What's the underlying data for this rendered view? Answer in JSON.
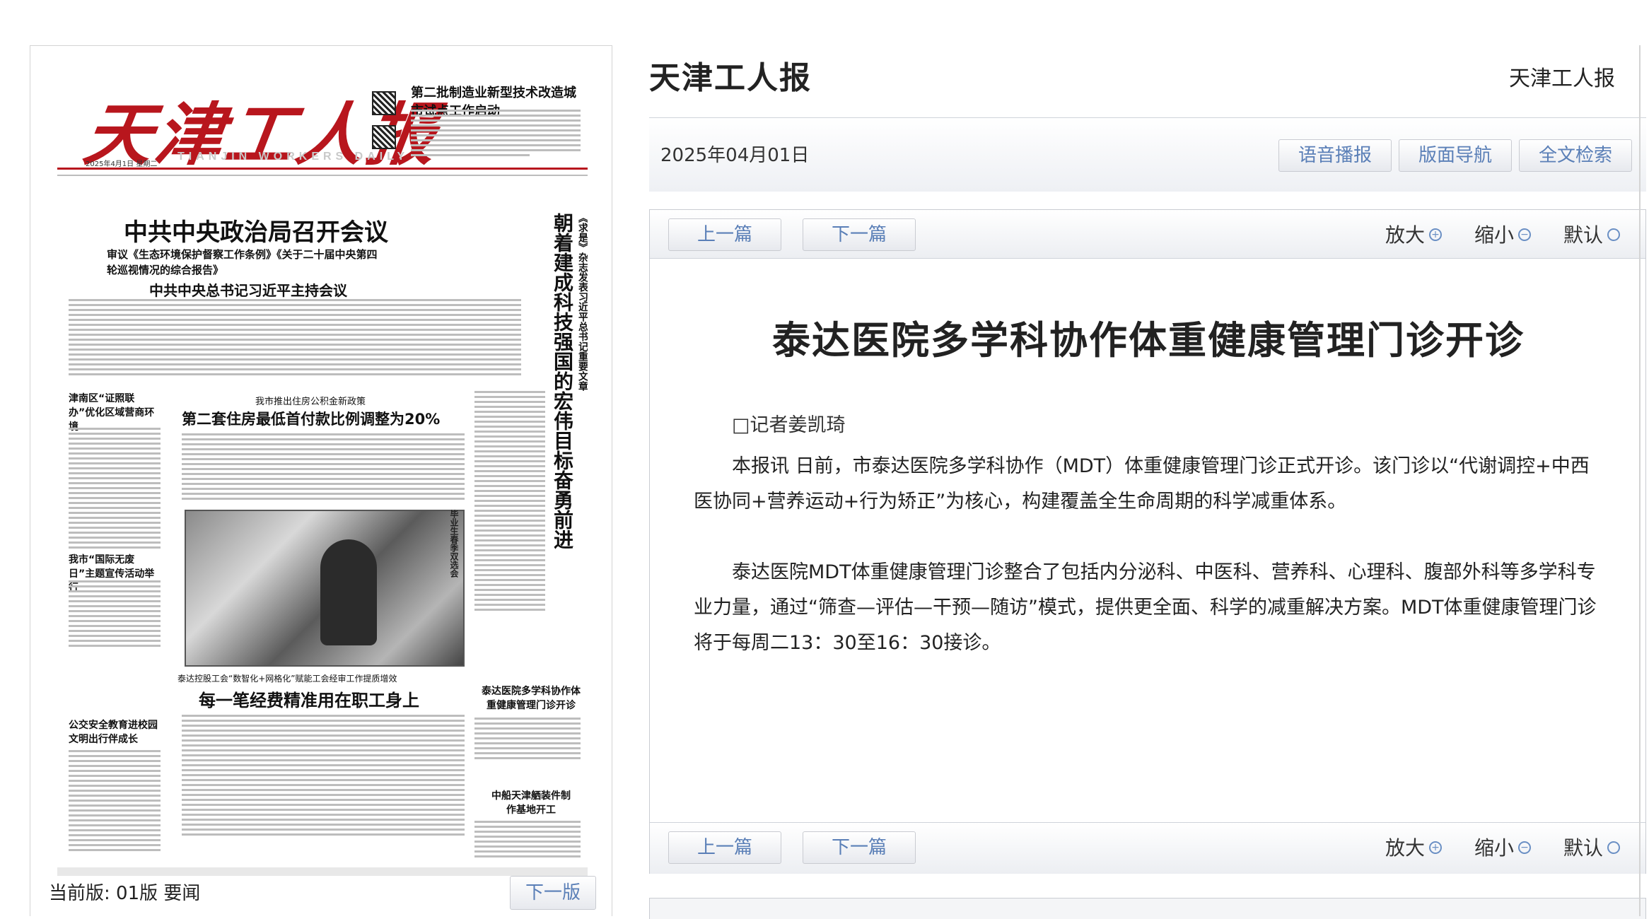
{
  "newspaper": {
    "logo_text": "天津工人报",
    "logo_english": "TIANJIN WORKERS DAILY",
    "top_story_right": "第二批制造业新型技术改造城市试点工作启动",
    "masthead_date": "2025年4月1日 星期二",
    "main_headline": "中共中央政治局召开会议",
    "sub_line_1": "审议《生态环境保护督察工作条例》《关于二十届中央第四",
    "sub_line_2": "轮巡视情况的综合报告》",
    "sub_line_3": "中共中央总书记习近平主持会议",
    "vertical_headline": "朝着建成科技强国的宏伟目标奋勇前进",
    "vertical_small": "《求是》杂志发表习近平总书记重要文章",
    "left_story_1": "津南区“证照联办”优化区域营商环境",
    "kicker_housing": "我市推出住房公积金新政策",
    "housing_headline": "第二套住房最低首付款比例调整为20%",
    "left_story_2": "我市“国际无废日”主题宣传活动举行",
    "photo_side": "毕业生春季双选会",
    "kicker_union": "泰达控股工会“数智化+网格化”赋能工会经审工作提质增效",
    "union_headline": "每一笔经费精准用在职工身上",
    "left_story_3": "公交安全教育进校园文明出行伴成长",
    "tteda_story": "泰达医院多学科协作体重健康管理门诊开诊",
    "ship_story": "中船天津舾装件制作基地开工"
  },
  "left_footer": {
    "current_edition": "当前版: 01版 要闻",
    "next_edition": "下一版"
  },
  "header": {
    "site_title": "天津工人报",
    "site_title_right": "天津工人报"
  },
  "date_bar": {
    "date": "2025年04月01日",
    "buttons": [
      "语音播报",
      "版面导航",
      "全文检索"
    ]
  },
  "article_toolbar": {
    "prev": "上一篇",
    "next": "下一篇",
    "zoom_in": "放大",
    "zoom_out": "缩小",
    "default": "默认"
  },
  "article": {
    "title": "泰达医院多学科协作体重健康管理门诊开诊",
    "reporter": "□记者姜凯琦",
    "paragraph_1": "本报讯 日前，市泰达医院多学科协作（MDT）体重健康管理门诊正式开诊。该门诊以“代谢调控+中西医协同+营养运动+行为矫正”为核心，构建覆盖全生命周期的科学减重体系。",
    "paragraph_2": "泰达医院MDT体重健康管理门诊整合了包括内分泌科、中医科、营养科、心理科、腹部外科等多学科专业力量，通过“筛查—评估—干预—随访”模式，提供更全面、科学的减重解决方案。MDT体重健康管理门诊将于每周二13：30至16：30接诊。"
  },
  "colors": {
    "accent_link": "#5a7fb7",
    "masthead_red": "#b8161d"
  }
}
